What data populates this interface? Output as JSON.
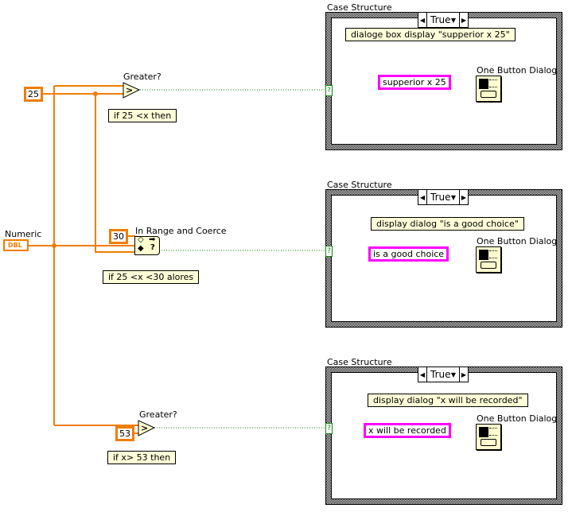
{
  "colors": {
    "numeric_wire": "#f07d00",
    "boolean_wire": "#0a8a0a",
    "string_wire": "#ff00ff",
    "comment_bg": "#ffffd8"
  },
  "controls": {
    "numeric": {
      "label": "Numeric",
      "type": "DBL"
    }
  },
  "constants": {
    "c25": "25",
    "c30": "30",
    "c53": "53"
  },
  "nodes": {
    "greater1": {
      "label": "Greater?",
      "symbol": ">",
      "comment": "if 25 <x then"
    },
    "inrange": {
      "label": "In Range and Coerce",
      "comment": "if 25 <x <30 alores"
    },
    "greater2": {
      "label": "Greater?",
      "symbol": ">",
      "comment": "if x> 53 then"
    }
  },
  "cases": [
    {
      "label": "Case Structure",
      "selector": "True",
      "tunnel": "?",
      "comment": "dialoge box display \"supperior x 25\"",
      "string": "supperior x 25",
      "dialog_label": "One Button Dialog"
    },
    {
      "label": "Case Structure",
      "selector": "True",
      "tunnel": "?",
      "comment": "display dialog \"is a good choice\"",
      "string": "is a good choice",
      "dialog_label": "One Button Dialog"
    },
    {
      "label": "Case Structure",
      "selector": "True",
      "tunnel": "?",
      "comment": "display dialog \"x will be recorded\"",
      "string": "x will be recorded",
      "dialog_label": "One Button Dialog"
    }
  ]
}
